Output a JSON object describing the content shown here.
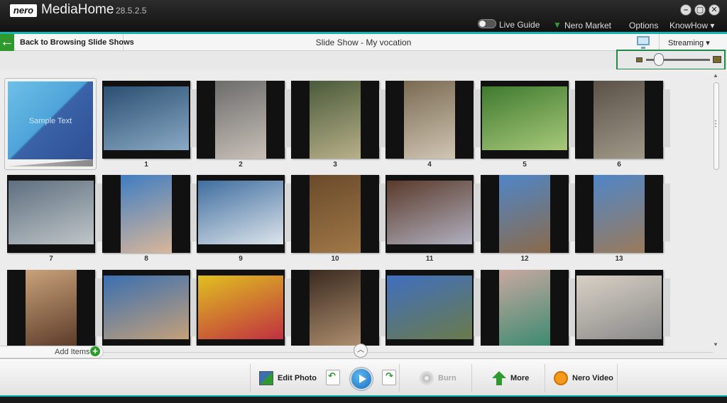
{
  "app": {
    "logo": "nero",
    "name": "MediaHome",
    "version": "28.5.2.5"
  },
  "window_buttons": {
    "minimize": "–",
    "restore": "▢",
    "close": "✕"
  },
  "top_links": {
    "live_guide": "Live Guide",
    "nero_market": "Nero Market",
    "options": "Options",
    "knowhow": "KnowHow ▾"
  },
  "header": {
    "back_label": "Back to Browsing Slide Shows",
    "title": "Slide Show - My vocation",
    "streaming": "Streaming ▾"
  },
  "sample": {
    "text": "Sample Text"
  },
  "zoom": {
    "value": 0.2
  },
  "tiles": [
    {
      "num": "1",
      "colors": [
        "#2b4f72",
        "#8aa9c4"
      ]
    },
    {
      "num": "2",
      "colors": [
        "#6c6c6c",
        "#c9c0b8"
      ]
    },
    {
      "num": "3",
      "colors": [
        "#4a5a3a",
        "#b8b08a"
      ]
    },
    {
      "num": "4",
      "colors": [
        "#7a6a52",
        "#d0c6b4"
      ]
    },
    {
      "num": "5",
      "colors": [
        "#3f7a2f",
        "#a8c97a"
      ]
    },
    {
      "num": "6",
      "colors": [
        "#5a5248",
        "#a09888"
      ]
    },
    {
      "num": "7",
      "colors": [
        "#5e6f80",
        "#c0c6c8"
      ]
    },
    {
      "num": "8",
      "colors": [
        "#3f7dc2",
        "#d9b79a"
      ]
    },
    {
      "num": "9",
      "colors": [
        "#3f6ea0",
        "#dde4ea"
      ]
    },
    {
      "num": "10",
      "colors": [
        "#6a4a2a",
        "#a07848"
      ]
    },
    {
      "num": "11",
      "colors": [
        "#5a3a2a",
        "#b0b0c0"
      ]
    },
    {
      "num": "12",
      "colors": [
        "#4f86c8",
        "#8a6a4a"
      ]
    },
    {
      "num": "13",
      "colors": [
        "#4f86c8",
        "#9a7a5a"
      ]
    },
    {
      "num": "",
      "colors": [
        "#c9a27a",
        "#5a3a28"
      ]
    },
    {
      "num": "",
      "colors": [
        "#3a6fb0",
        "#c4a07a"
      ]
    },
    {
      "num": "",
      "colors": [
        "#e0c020",
        "#c03040"
      ]
    },
    {
      "num": "",
      "colors": [
        "#3a2a20",
        "#b09070"
      ]
    },
    {
      "num": "",
      "colors": [
        "#3f6fc0",
        "#6a7a4a"
      ]
    },
    {
      "num": "",
      "colors": [
        "#c8a8a0",
        "#3a8a70"
      ]
    },
    {
      "num": "",
      "colors": [
        "#d8d0c4",
        "#8a8a8a"
      ]
    }
  ],
  "add_items": {
    "label": "Add Items",
    "icon": "+"
  },
  "bottom": {
    "edit_photo": "Edit Photo",
    "burn": "Burn",
    "more": "More",
    "nero_video": "Nero Video"
  }
}
